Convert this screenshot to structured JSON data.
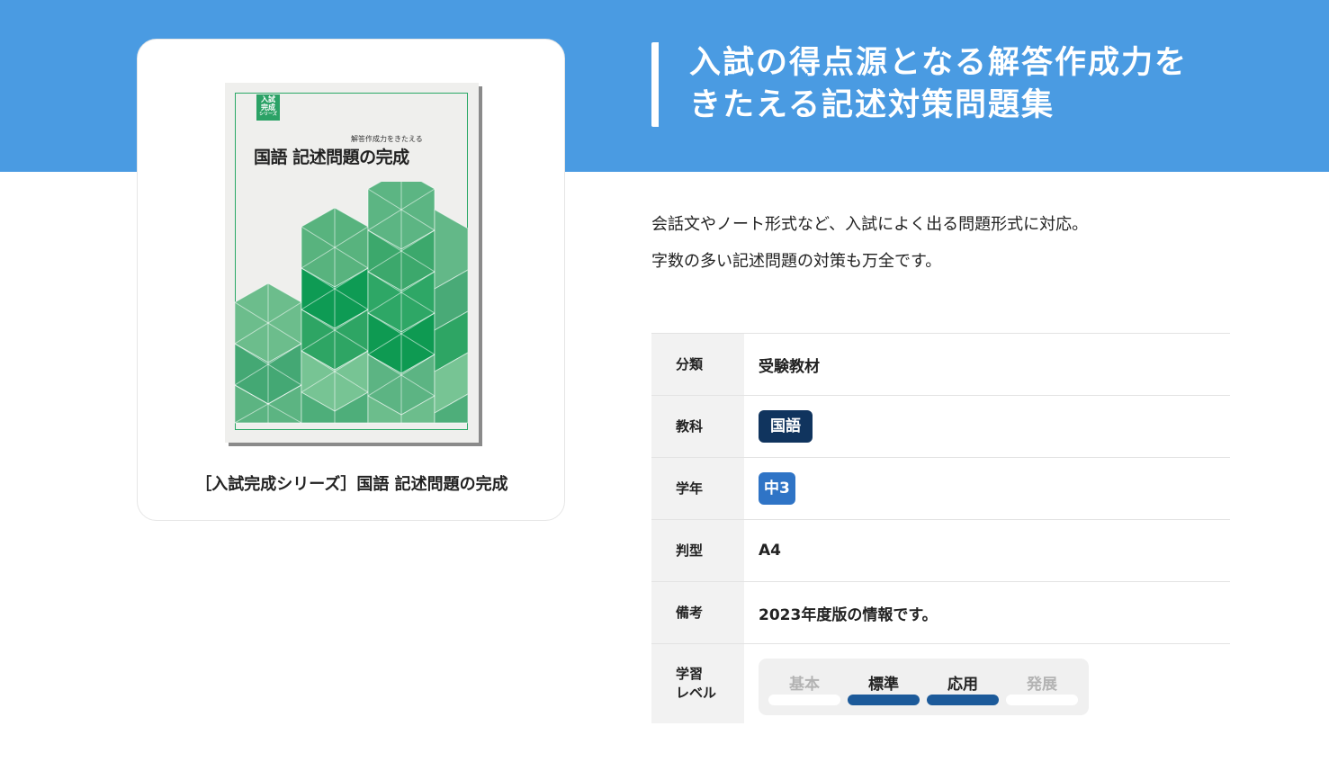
{
  "headline": {
    "line1": "入試の得点源となる解答作成力を",
    "line2": "きたえる記述対策問題集"
  },
  "description": {
    "line1": "会話文やノート形式など、入試によく出る問題形式に対応。",
    "line2": "字数の多い記述問題の対策も万全です。"
  },
  "book": {
    "caption": "［入試完成シリーズ］国語 記述問題の完成",
    "cover": {
      "series_badge_line1": "入試",
      "series_badge_line2": "完成",
      "series_badge_small": "シリーズ",
      "subtitle": "解答作成力をきたえる",
      "title": "国語  記述問題の完成",
      "accent_color": "#2ba266"
    }
  },
  "specs": {
    "category": {
      "label": "分類",
      "value": "受験教材"
    },
    "subject": {
      "label": "教科",
      "value": "国語"
    },
    "grade": {
      "label": "学年",
      "value": "中3"
    },
    "size": {
      "label": "判型",
      "value": "A4"
    },
    "note": {
      "label": "備考",
      "value": "2023年度版の情報です。"
    },
    "level": {
      "label_line1": "学習",
      "label_line2": "レベル",
      "levels": [
        {
          "name": "基本",
          "active": false
        },
        {
          "name": "標準",
          "active": true
        },
        {
          "name": "応用",
          "active": true
        },
        {
          "name": "発展",
          "active": false
        }
      ]
    }
  },
  "colors": {
    "header_band": "#4a9be2",
    "subject_chip": "#10345e",
    "grade_chip": "#2f74c6",
    "level_active": "#1c5a9a"
  }
}
